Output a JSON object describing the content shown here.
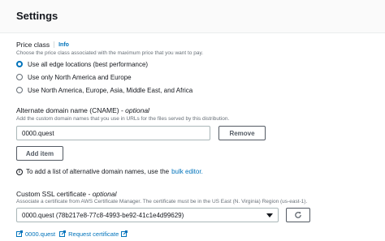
{
  "header": {
    "title": "Settings"
  },
  "price_class": {
    "label": "Price class",
    "info": "Info",
    "description": "Choose the price class associated with the maximum price that you want to pay.",
    "options": [
      {
        "label": "Use all edge locations (best performance)",
        "selected": true
      },
      {
        "label": "Use only North America and Europe",
        "selected": false
      },
      {
        "label": "Use North America, Europe, Asia, Middle East, and Africa",
        "selected": false
      }
    ]
  },
  "cname": {
    "label": "Alternate domain name (CNAME) -",
    "optional": "optional",
    "description": "Add the custom domain names that you use in URLs for the files served by this distribution.",
    "value": "0000.quest",
    "remove_label": "Remove",
    "add_label": "Add item",
    "hint_text": "To add a list of alternative domain names, use the",
    "hint_link": "bulk editor."
  },
  "ssl": {
    "label": "Custom SSL certificate -",
    "optional": "optional",
    "description": "Associate a certificate from AWS Certificate Manager. The certificate must be in the US East (N. Virginia) Region (us-east-1).",
    "selected": "0000.quest (78b217e8-77c8-4993-be92-41c1e4d99629)",
    "link_cert": "0000.quest",
    "link_request": "Request certificate"
  },
  "colors": {
    "accent": "#0073bb",
    "text": "#16191f",
    "muted": "#687078"
  }
}
